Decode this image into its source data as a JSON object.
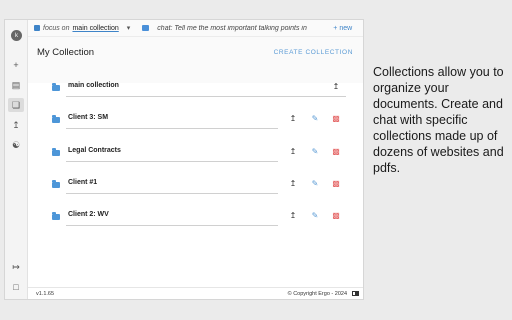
{
  "sidebar": {
    "avatar_initial": "k",
    "icons": [
      "plus-icon",
      "collection-list-icon",
      "collections-icon",
      "upload-icon",
      "users-icon",
      "logout-icon",
      "bookmark-icon"
    ]
  },
  "topbar": {
    "focus_label": "focus on",
    "focus_value": "main collection",
    "chat_label": "chat: Tell me the most important talking points in",
    "new_label": "+ new"
  },
  "header": {
    "title": "My Collection",
    "create_label": "CREATE COLLECTION"
  },
  "collections": [
    {
      "name": "main collection",
      "editable": false
    },
    {
      "name": "Client 3: SM",
      "editable": true
    },
    {
      "name": "Legal Contracts",
      "editable": true
    },
    {
      "name": "Client #1",
      "editable": true
    },
    {
      "name": "Client 2: WV",
      "editable": true
    }
  ],
  "footer": {
    "version": "v1.1.65",
    "copyright": "© Copyright Ergo - 2024"
  },
  "caption": "Collections allow you to organize your documents. Create and chat with specific collections made up of dozens of websites and pdfs.",
  "colors": {
    "accent": "#5b9bd5",
    "folder": "#4d96d8",
    "delete": "#e35c5c"
  }
}
